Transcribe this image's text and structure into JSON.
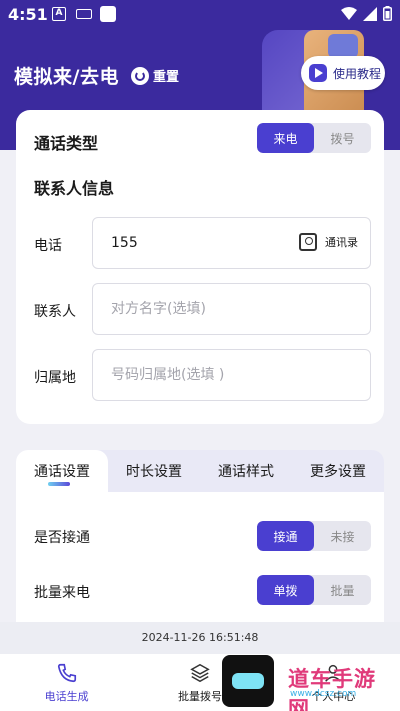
{
  "status_bar": {
    "time": "4:51",
    "a_icon_label": "A"
  },
  "header": {
    "title": "模拟来/去电",
    "reset_label": "重置",
    "tutorial_label": "使用教程"
  },
  "call_type": {
    "label": "通话类型",
    "options": [
      "来电",
      "拨号"
    ],
    "selected": "来电"
  },
  "contact_info": {
    "title": "联系人信息",
    "phone_label": "电话",
    "phone_value": "155",
    "contacts_button": "通讯录",
    "name_label": "联系人",
    "name_placeholder": "对方名字(选填)",
    "location_label": "归属地",
    "location_placeholder": "号码归属地(选填 )"
  },
  "tabs": [
    "通话设置",
    "时长设置",
    "通话样式",
    "更多设置"
  ],
  "settings": {
    "answer": {
      "label": "是否接通",
      "options": [
        "接通",
        "未接"
      ],
      "selected": "接通"
    },
    "batch": {
      "label": "批量来电",
      "options": [
        "单拨",
        "批量"
      ],
      "selected": "单拨"
    }
  },
  "timestamp": "2024-11-26 16:51:48",
  "bottom_nav": [
    {
      "label": "电话生成",
      "icon": "phone-icon",
      "active": true
    },
    {
      "label": "批量拨号",
      "icon": "layers-icon",
      "active": false
    },
    {
      "label": "个人中心",
      "icon": "person-icon",
      "active": false
    }
  ],
  "watermark": {
    "text": "道车手游网",
    "url": "www.dcsz.com"
  },
  "colors": {
    "primary": "#4a3fd0",
    "header_bg": "#3b2a9e",
    "page_bg": "#f0f0f6"
  }
}
